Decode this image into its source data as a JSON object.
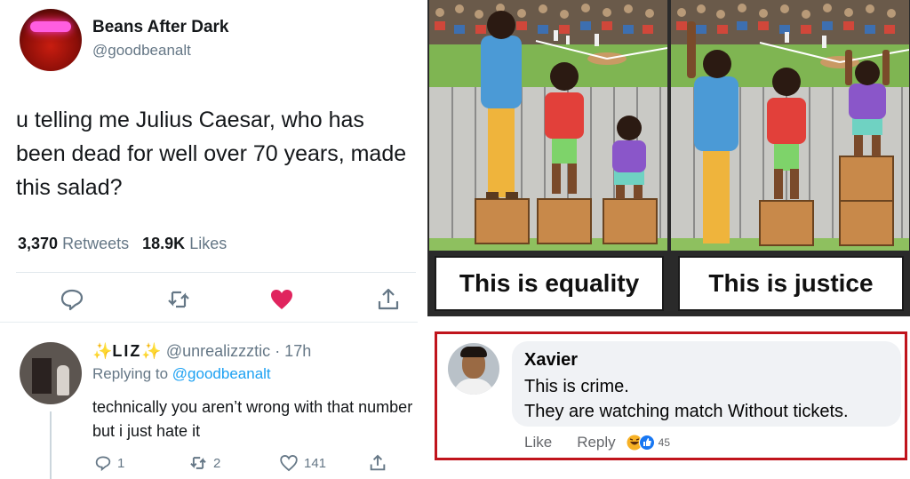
{
  "tweet": {
    "name": "Beans After Dark",
    "handle": "@goodbeanalt",
    "text": "u telling me Julius Caesar, who has been dead for well over 70 years, made this salad?",
    "retweets_count": "3,370",
    "retweets_label": "Retweets",
    "likes_count": "18.9K",
    "likes_label": "Likes",
    "actions": [
      "reply-icon",
      "retweet-icon",
      "like-icon",
      "share-icon"
    ],
    "like_color": "#e0245e"
  },
  "reply": {
    "name": "LIZ",
    "handle": "@unrealizzztic",
    "time": "· 17h",
    "replying_prefix": "Replying to",
    "replying_to": "@goodbeanalt",
    "text": "technically you aren’t wrong with that number but i just hate it",
    "reply_count": "1",
    "retweet_count": "2",
    "like_count": "141"
  },
  "comic": {
    "caption_left": "This is equality",
    "caption_right": "This is justice"
  },
  "fb_comment": {
    "name": "Xavier",
    "line1": "This is crime.",
    "line2": "They are watching match Without tickets.",
    "like_label": "Like",
    "reply_label": "Reply",
    "reaction_count": "45",
    "border_color": "#c0141c"
  }
}
